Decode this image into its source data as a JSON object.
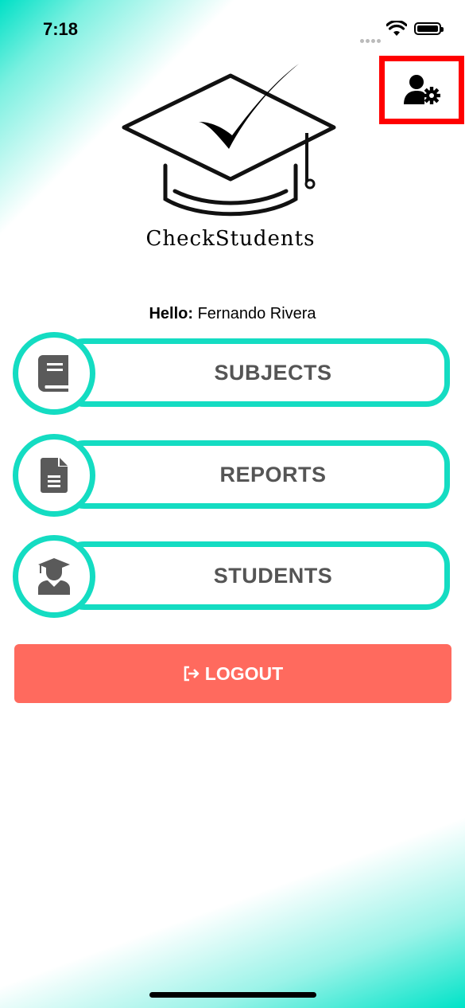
{
  "status_bar": {
    "time": "7:18"
  },
  "header": {
    "settings_icon": "user-gear-icon"
  },
  "logo": {
    "text": "CheckStudents"
  },
  "greeting": {
    "prefix": "Hello:",
    "name": "Fernando Rivera"
  },
  "menu": [
    {
      "label": "SUBJECTS",
      "icon": "book-icon"
    },
    {
      "label": "REPORTS",
      "icon": "document-icon"
    },
    {
      "label": "STUDENTS",
      "icon": "graduate-icon"
    }
  ],
  "logout": {
    "label": "LOGOUT",
    "icon": "logout-icon"
  },
  "colors": {
    "accent": "#14dcc2",
    "logout": "#ff6a5e",
    "highlight": "#ff0000",
    "text": "#555555"
  }
}
